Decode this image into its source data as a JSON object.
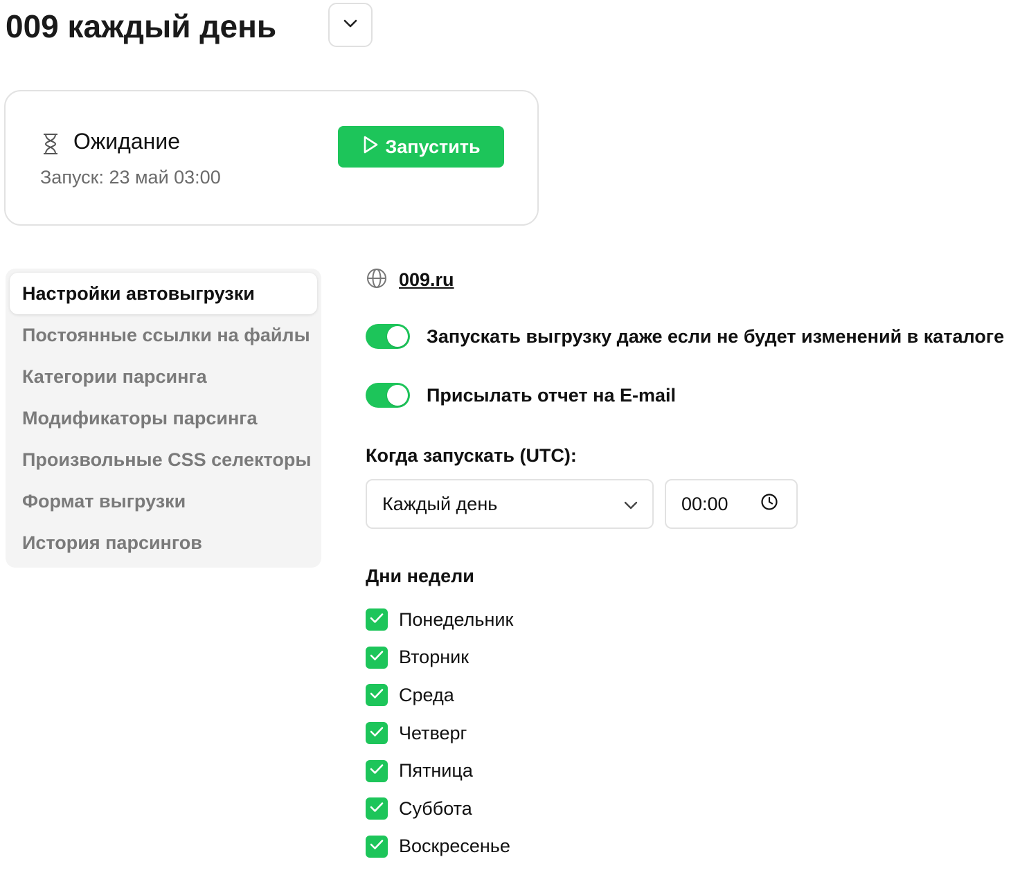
{
  "header": {
    "title": "009 каждый день"
  },
  "status": {
    "label": "Ожидание",
    "next_run": "Запуск: 23 май 03:00",
    "run_button": "Запустить"
  },
  "sidebar": {
    "items": [
      {
        "label": "Настройки автовыгрузки",
        "active": true
      },
      {
        "label": "Постоянные ссылки на файлы"
      },
      {
        "label": "Категории парсинга"
      },
      {
        "label": "Модификаторы парсинга"
      },
      {
        "label": "Произвольные CSS селекторы"
      },
      {
        "label": "Формат выгрузки"
      },
      {
        "label": "История парсингов"
      }
    ]
  },
  "settings": {
    "site": "009.ru",
    "toggles": [
      {
        "label": "Запускать выгрузку даже если не будет изменений в каталоге",
        "on": true
      },
      {
        "label": "Присылать отчет на E-mail",
        "on": true
      }
    ],
    "when_label": "Когда запускать (UTC):",
    "frequency": "Каждый день",
    "time": "00:00",
    "days_label": "Дни недели",
    "days": [
      {
        "label": "Понедельник",
        "checked": true
      },
      {
        "label": "Вторник",
        "checked": true
      },
      {
        "label": "Среда",
        "checked": true
      },
      {
        "label": "Четверг",
        "checked": true
      },
      {
        "label": "Пятница",
        "checked": true
      },
      {
        "label": "Суббота",
        "checked": true
      },
      {
        "label": "Воскресенье",
        "checked": true
      }
    ]
  },
  "colors": {
    "accent": "#1dc55a",
    "muted_text": "#7a7a7a",
    "sidebar_bg": "#f4f4f4"
  }
}
